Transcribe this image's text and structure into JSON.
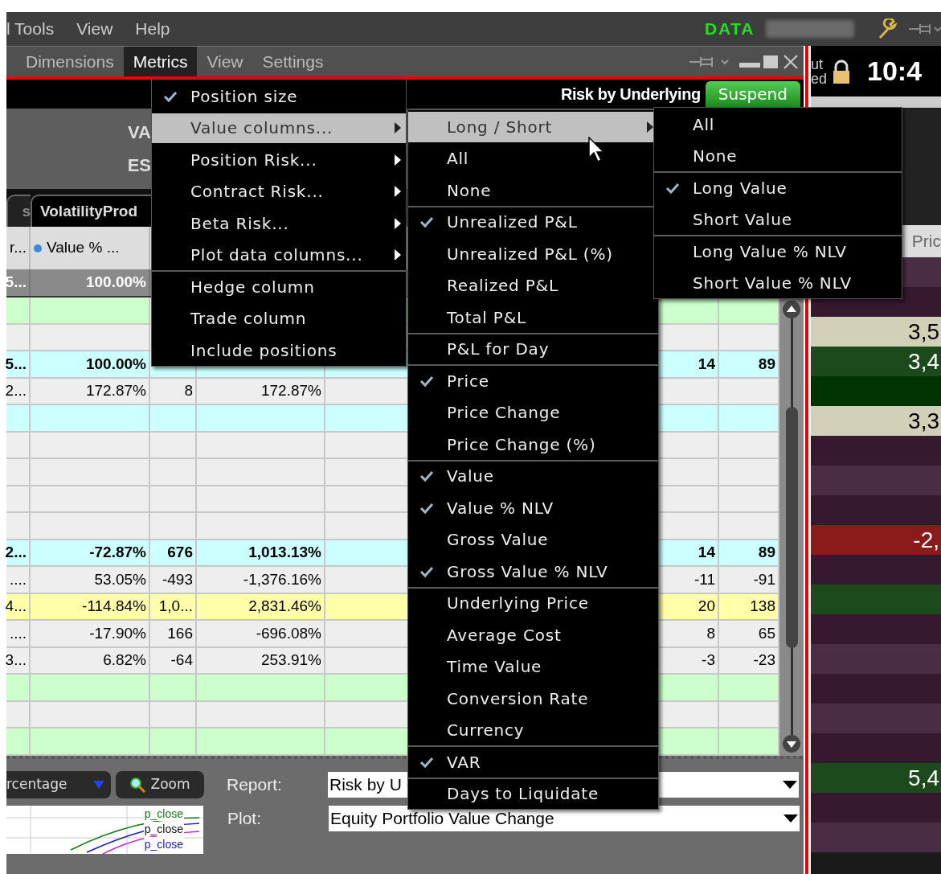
{
  "top_menu": {
    "items": [
      "l Tools",
      "View",
      "Help"
    ],
    "data_label": "DATA"
  },
  "window": {
    "menu": [
      {
        "label": "Dimensions",
        "selected": false
      },
      {
        "label": "Metrics",
        "selected": true
      },
      {
        "label": "View",
        "selected": false
      },
      {
        "label": "Settings",
        "selected": false
      }
    ],
    "title": "Risk by Underlying",
    "suspend_button": "Suspend",
    "header_lines": [
      "VA",
      "ES"
    ],
    "tabs": [
      {
        "label": "s",
        "selected": false
      },
      {
        "label": "VolatilityProd",
        "selected": true
      }
    ],
    "columns": {
      "column_1": "r...",
      "value_pct": "Value % ..."
    },
    "total_row": {
      "column_1": "5...",
      "value_pct": "100.00%"
    },
    "rows": [
      {
        "color": "#ccffcc",
        "cells": {}
      },
      {
        "color": "#eeeeee",
        "cells": {}
      },
      {
        "color": "#ccffff",
        "bold": true,
        "cells": {
          "column_1": "5...",
          "value_pct": "100.00%",
          "column_6": "14",
          "column_7": "89"
        }
      },
      {
        "color": "#eeeeee",
        "bold": false,
        "cells": {
          "column_1": "2...",
          "value_pct": "172.87%",
          "column_3": "8",
          "column_4": "172.87%"
        }
      },
      {
        "color": "#ccffff",
        "cells": {}
      },
      {
        "color": "#eeeeee",
        "cells": {}
      },
      {
        "color": "#eeeeee",
        "cells": {}
      },
      {
        "color": "#eeeeee",
        "cells": {}
      },
      {
        "color": "#eeeeee",
        "cells": {}
      },
      {
        "color": "#ccffff",
        "bold": true,
        "cells": {
          "column_1": "2...",
          "value_pct": "-72.87%",
          "column_3": "676",
          "column_4": "1,013.13%",
          "column_6": "14",
          "column_7": "89"
        }
      },
      {
        "color": "#eeeeee",
        "bold": false,
        "cells": {
          "column_1": "....",
          "value_pct": "53.05%",
          "column_3": "-493",
          "column_4": "-1,376.16%",
          "column_6": "-11",
          "column_7": "-91"
        }
      },
      {
        "color": "#ffffaa",
        "bold": false,
        "cells": {
          "column_1": "4...",
          "value_pct": "-114.84%",
          "column_3": "1,0...",
          "column_4": "2,831.46%",
          "column_6": "20",
          "column_7": "138"
        }
      },
      {
        "color": "#eeeeee",
        "bold": false,
        "cells": {
          "column_1": "....",
          "value_pct": "-17.90%",
          "column_3": "166",
          "column_4": "-696.08%",
          "column_6": "8",
          "column_7": "65"
        }
      },
      {
        "color": "#eeeeee",
        "bold": false,
        "cells": {
          "column_1": "3...",
          "value_pct": "6.82%",
          "column_3": "-64",
          "column_4": "253.91%",
          "column_6": "-3",
          "column_7": "-23"
        }
      },
      {
        "color": "#ccffcc",
        "cells": {}
      },
      {
        "color": "#eeeeee",
        "cells": {}
      },
      {
        "color": "#ccffcc",
        "cells": {}
      }
    ]
  },
  "right_panel": {
    "status": [
      "ut",
      "ed"
    ],
    "clock": "10:4",
    "column": "Pric",
    "rows": [
      {
        "color": "#4a2d45"
      },
      {
        "color": "#36182f"
      },
      {
        "color": "#d3d0b8",
        "value": "3,5"
      },
      {
        "color": "#1c4a1c",
        "value": "3,4"
      },
      {
        "color": "#003300"
      },
      {
        "color": "#d3d0b8",
        "value": "3,3"
      },
      {
        "color": "#36182f"
      },
      {
        "color": "#4a2d45"
      },
      {
        "color": "#36182f"
      },
      {
        "color": "#8b1a1a",
        "value": "-2,"
      },
      {
        "color": "#36182f"
      },
      {
        "color": "#1c4a1c"
      },
      {
        "color": "#36182f"
      },
      {
        "color": "#4a2d45"
      },
      {
        "color": "#36182f"
      },
      {
        "color": "#4a2d45"
      },
      {
        "color": "#36182f"
      },
      {
        "color": "#1c4a1c",
        "value": "5,4"
      },
      {
        "color": "#36182f"
      },
      {
        "color": "#4a2d45"
      }
    ]
  },
  "bottom": {
    "scale_dropdown": "rcentage",
    "zoom_button": "Zoom",
    "report": {
      "label": "Report:",
      "value": "Risk by U"
    },
    "plot": {
      "label": "Plot:",
      "value": "Equity Portfolio Value Change"
    },
    "legend": [
      {
        "label": "p_close",
        "color": "#1a7a1a"
      },
      {
        "label": "p_close",
        "color": "#111111"
      },
      {
        "label": "p_close",
        "color": "#1a1acc"
      }
    ]
  },
  "menus": [
    {
      "items": [
        {
          "label": "Position size",
          "checked": true,
          "selected": false,
          "submenu": false,
          "divider": false
        },
        {
          "label": "Value columns...",
          "checked": false,
          "selected": true,
          "submenu": true,
          "divider": false
        },
        {
          "label": "Position Risk...",
          "checked": false,
          "selected": false,
          "submenu": true,
          "divider": false
        },
        {
          "label": "Contract Risk...",
          "checked": false,
          "selected": false,
          "submenu": true,
          "divider": false
        },
        {
          "label": "Beta Risk...",
          "checked": false,
          "selected": false,
          "submenu": true,
          "divider": false
        },
        {
          "label": "Plot data columns...",
          "checked": false,
          "selected": false,
          "submenu": true,
          "divider": false
        },
        {
          "label": "Hedge column",
          "checked": false,
          "selected": false,
          "submenu": false,
          "divider": true
        },
        {
          "label": "Trade column",
          "checked": false,
          "selected": false,
          "submenu": false,
          "divider": false
        },
        {
          "label": "Include positions",
          "checked": false,
          "selected": false,
          "submenu": false,
          "divider": false
        }
      ]
    },
    {
      "items": [
        {
          "label": "Long / Short",
          "checked": false,
          "selected": true,
          "submenu": true,
          "divider": false
        },
        {
          "label": "All",
          "checked": false,
          "selected": false,
          "submenu": false,
          "divider": false
        },
        {
          "label": "None",
          "checked": false,
          "selected": false,
          "submenu": false,
          "divider": false
        },
        {
          "label": "Unrealized P&L",
          "checked": true,
          "selected": false,
          "submenu": false,
          "divider": true
        },
        {
          "label": "Unrealized P&L (%)",
          "checked": false,
          "selected": false,
          "submenu": false,
          "divider": false
        },
        {
          "label": "Realized P&L",
          "checked": false,
          "selected": false,
          "submenu": false,
          "divider": false
        },
        {
          "label": "Total P&L",
          "checked": false,
          "selected": false,
          "submenu": false,
          "divider": false
        },
        {
          "label": "P&L for Day",
          "checked": false,
          "selected": false,
          "submenu": false,
          "divider": true
        },
        {
          "label": "Price",
          "checked": true,
          "selected": false,
          "submenu": false,
          "divider": true
        },
        {
          "label": "Price Change",
          "checked": false,
          "selected": false,
          "submenu": false,
          "divider": false
        },
        {
          "label": "Price Change (%)",
          "checked": false,
          "selected": false,
          "submenu": false,
          "divider": false
        },
        {
          "label": "Value",
          "checked": true,
          "selected": false,
          "submenu": false,
          "divider": true
        },
        {
          "label": "Value % NLV",
          "checked": true,
          "selected": false,
          "submenu": false,
          "divider": false
        },
        {
          "label": "Gross Value",
          "checked": false,
          "selected": false,
          "submenu": false,
          "divider": false
        },
        {
          "label": "Gross Value % NLV",
          "checked": true,
          "selected": false,
          "submenu": false,
          "divider": false
        },
        {
          "label": "Underlying Price",
          "checked": false,
          "selected": false,
          "submenu": false,
          "divider": true
        },
        {
          "label": "Average Cost",
          "checked": false,
          "selected": false,
          "submenu": false,
          "divider": false
        },
        {
          "label": "Time Value",
          "checked": false,
          "selected": false,
          "submenu": false,
          "divider": false
        },
        {
          "label": "Conversion Rate",
          "checked": false,
          "selected": false,
          "submenu": false,
          "divider": false
        },
        {
          "label": "Currency",
          "checked": false,
          "selected": false,
          "submenu": false,
          "divider": false
        },
        {
          "label": "VAR",
          "checked": true,
          "selected": false,
          "submenu": false,
          "divider": true
        },
        {
          "label": "Days to Liquidate",
          "checked": false,
          "selected": false,
          "submenu": false,
          "divider": true
        }
      ]
    },
    {
      "items": [
        {
          "label": "All",
          "checked": false,
          "selected": false,
          "submenu": false,
          "divider": false
        },
        {
          "label": "None",
          "checked": false,
          "selected": false,
          "submenu": false,
          "divider": false
        },
        {
          "label": "Long Value",
          "checked": true,
          "selected": false,
          "submenu": false,
          "divider": true
        },
        {
          "label": "Short Value",
          "checked": false,
          "selected": false,
          "submenu": false,
          "divider": false
        },
        {
          "label": "Long Value % NLV",
          "checked": false,
          "selected": false,
          "submenu": false,
          "divider": true
        },
        {
          "label": "Short Value % NLV",
          "checked": false,
          "selected": false,
          "submenu": false,
          "divider": false
        }
      ]
    }
  ]
}
